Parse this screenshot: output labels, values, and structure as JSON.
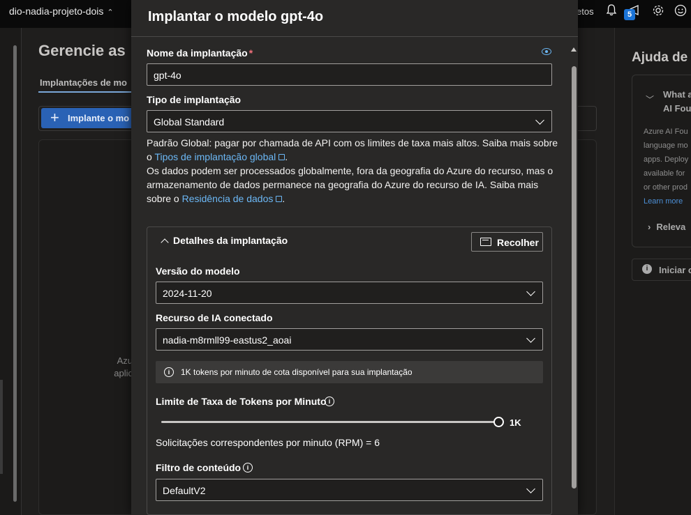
{
  "topbar": {
    "project": "dio-nadia-projeto-dois",
    "partial_label": "etos",
    "notification_count": "5"
  },
  "background": {
    "page_title": "Gerencie as",
    "tab_label": "Implantações de mo",
    "deploy_button": "Implante o mo",
    "empty_text_1": "Azu",
    "empty_text_2": "aplic",
    "help_title": "Ajuda de",
    "help_question_1": "What a",
    "help_question_2": "AI Fou",
    "help_body": [
      "Azure AI Fou",
      "language mo",
      "apps. Deploy",
      "available for",
      "or other prod"
    ],
    "help_link": "Learn more",
    "help_relevant": "Releva",
    "help_start": "Iniciar o"
  },
  "modal": {
    "title": "Implantar o modelo gpt-4o",
    "name_label": "Nome da implantação",
    "name_required": "*",
    "name_value": "gpt-4o",
    "type_label": "Tipo de implantação",
    "type_value": "Global Standard",
    "desc_p1_text": "Padrão Global: pagar por chamada de API com os limites de taxa mais altos. Saiba mais sobre o ",
    "desc_p1_link": "Tipos de implantação global",
    "desc_p1_end": ".",
    "desc_p2_text": "Os dados podem ser processados globalmente, fora da geografia do Azure do recurso, mas o armazenamento de dados permanece na geografia do Azure do recurso de IA. Saiba mais sobre o ",
    "desc_p2_link": "Residência de dados",
    "desc_p2_end": ".",
    "details_title": "Detalhes da implantação",
    "collapse_button": "Recolher",
    "version_label": "Versão do modelo",
    "version_value": "2024-11-20",
    "resource_label": "Recurso de IA conectado",
    "resource_value": "nadia-m8rmll99-eastus2_aoai",
    "quota_info": "1K tokens por minuto de cota disponível para sua implantação",
    "rate_label": "Limite de Taxa de Tokens por Minuto",
    "rate_value": "1K",
    "rate_fraction": 1.0,
    "rpm_text": "Solicitações correspondentes por minuto (RPM) = 6",
    "filter_label": "Filtro de conteúdo",
    "filter_value": "DefaultV2"
  },
  "colors": {
    "accent": "#6cb8f6",
    "modal_bg": "#292827",
    "primary_button": "#2a62b5"
  }
}
